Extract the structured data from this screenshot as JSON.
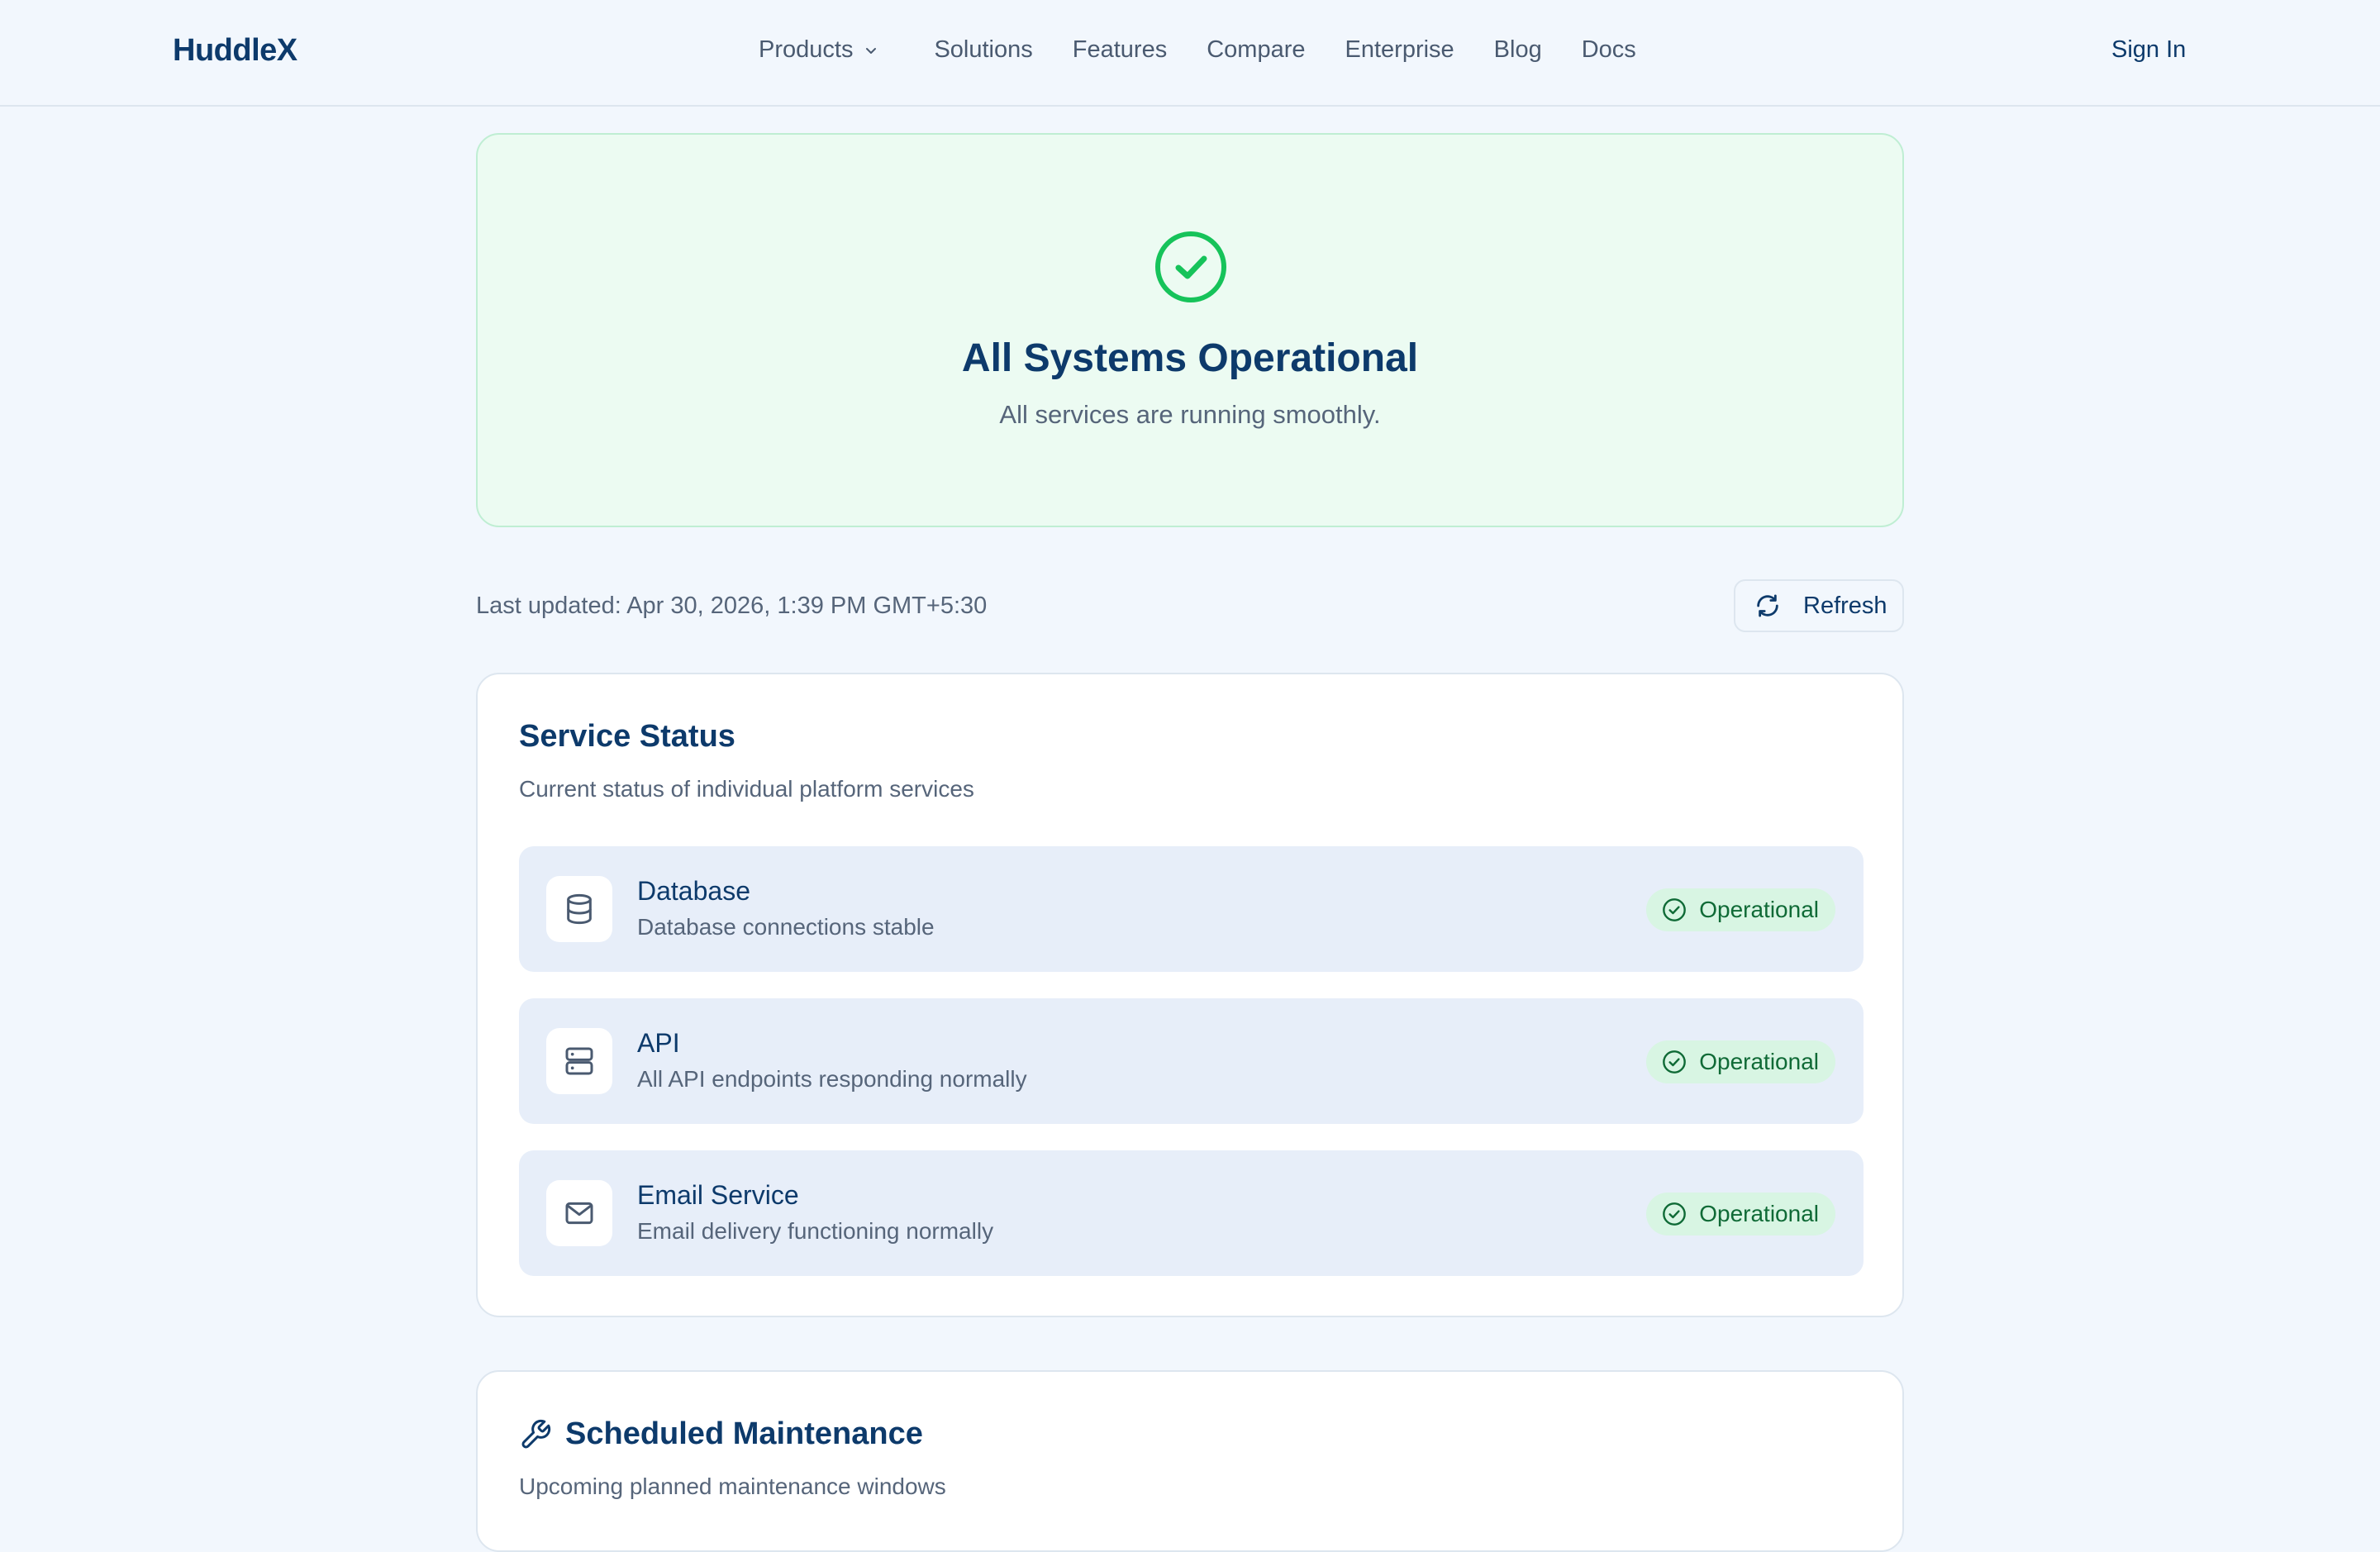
{
  "header": {
    "logo": "HuddleX",
    "nav": [
      {
        "label": "Products"
      },
      {
        "label": "Solutions"
      },
      {
        "label": "Features"
      },
      {
        "label": "Compare"
      },
      {
        "label": "Enterprise"
      },
      {
        "label": "Blog"
      },
      {
        "label": "Docs"
      }
    ],
    "sign_in": "Sign In"
  },
  "hero": {
    "icon": "check-circle-icon",
    "title": "All Systems Operational",
    "subtitle": "All services are running smoothly.",
    "accent_color": "#16c35a"
  },
  "status_bar": {
    "last_updated": "Last updated: Apr 30, 2026, 1:39 PM GMT+5:30",
    "refresh_label": "Refresh"
  },
  "service_status": {
    "title": "Service Status",
    "description": "Current status of individual platform services",
    "services": [
      {
        "icon": "database-icon",
        "name": "Database",
        "description": "Database connections stable",
        "status": "Operational"
      },
      {
        "icon": "server-icon",
        "name": "API",
        "description": "All API endpoints responding normally",
        "status": "Operational"
      },
      {
        "icon": "mail-icon",
        "name": "Email Service",
        "description": "Email delivery functioning normally",
        "status": "Operational"
      }
    ]
  },
  "maintenance": {
    "icon": "wrench-icon",
    "title": "Scheduled Maintenance",
    "description": "Upcoming planned maintenance windows"
  },
  "colors": {
    "brand": "#0d3a6b",
    "operational": "#0f6a36",
    "background": "#f2f7fd"
  }
}
